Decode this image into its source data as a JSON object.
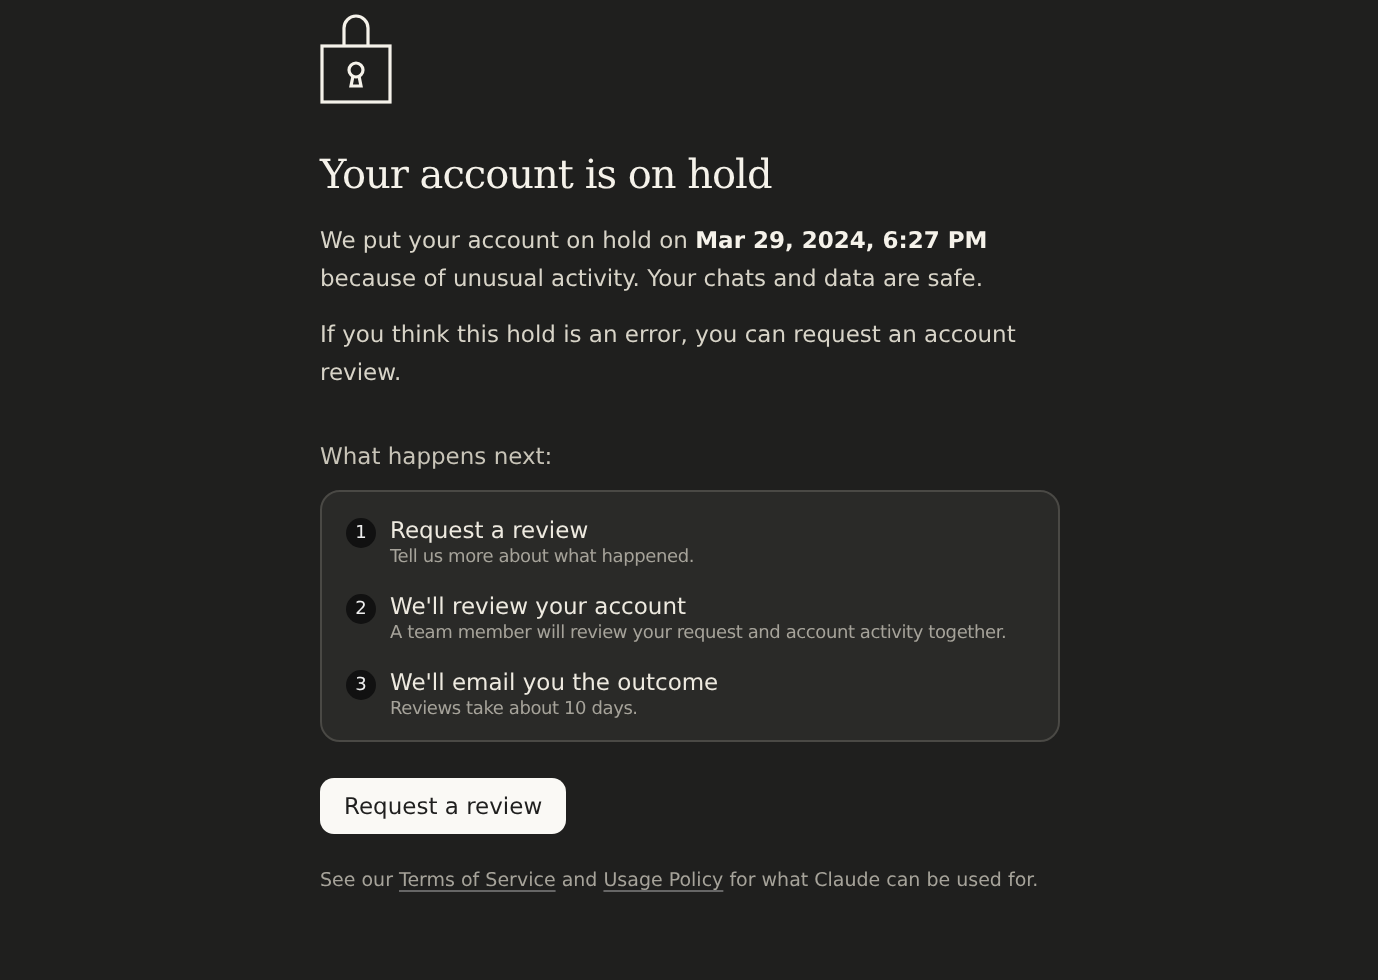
{
  "title": "Your account is on hold",
  "intro": "We put your account on hold on **Mar 29, 2024, 6:27 PM** because of unusual activity. Your chats and data are safe.",
  "note": "If you think this hold is an error, you can request an account review.",
  "steps_heading": "What happens next:",
  "steps": [
    {
      "number": "1",
      "title": "Request a review",
      "detail": "Tell us more about what happened."
    },
    {
      "number": "2",
      "title": "We'll review your account",
      "detail": "A team member will review your request and account activity together."
    },
    {
      "number": "3",
      "title": "We'll email you the outcome",
      "detail": "Reviews take about 10 days."
    }
  ],
  "button": "Request a review",
  "footer": [
    {
      "kind": "text",
      "text": "See our "
    },
    {
      "kind": "link",
      "text": "Terms of Service"
    },
    {
      "kind": "text",
      "text": " and "
    },
    {
      "kind": "link",
      "text": "Usage Policy"
    },
    {
      "kind": "text",
      "text": " for what Claude can be used for."
    }
  ]
}
